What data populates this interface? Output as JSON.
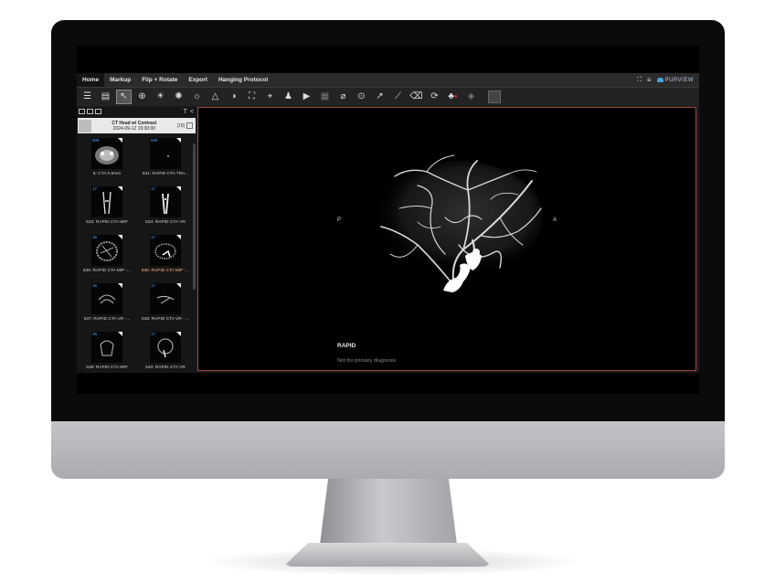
{
  "menu": {
    "items": [
      "Home",
      "Markup",
      "Flip + Rotate",
      "Export",
      "Hanging Protocol"
    ],
    "active": "Home"
  },
  "brand": {
    "name": "PURVIEW",
    "color": "#4aa3df"
  },
  "toolbar": {
    "tools": [
      "list-icon",
      "document-icon",
      "pointer-icon",
      "zoom-icon",
      "brightness-icon",
      "contrast-sun-icon",
      "window-level-icon",
      "triangle-dropdown-icon",
      "invert-icon",
      "fit-icon",
      "crosshair-icon",
      "person-icon",
      "play-icon",
      "layout-icon",
      "link-icon",
      "magnify-icon",
      "arrow-icon",
      "ruler-icon",
      "eraser-icon",
      "rotate-icon",
      "user-record-icon",
      "cube-icon",
      "box-icon"
    ]
  },
  "study": {
    "name": "CT Head w/ Contrast",
    "date": "2024-09-12 19:30:00",
    "badge": "[18]"
  },
  "series": [
    {
      "number": "609",
      "label": "5: CTA 0.5mm",
      "selected": false
    },
    {
      "number": "609",
      "label": "531: RAPID CTA Thin...",
      "selected": false
    },
    {
      "number": "17",
      "label": "533: RAPID CTA MIP",
      "selected": false
    },
    {
      "number": "17",
      "label": "534: RAPID CTA VR",
      "selected": false
    },
    {
      "number": "36",
      "label": "535: RAPID CTA MIP -...",
      "selected": false
    },
    {
      "number": "17",
      "label": "536: RAPID CTA MIP -...",
      "selected": true
    },
    {
      "number": "36",
      "label": "537: RAPID CTA VR -...",
      "selected": false
    },
    {
      "number": "17",
      "label": "538: RAPID CTA VR - ...",
      "selected": false
    },
    {
      "number": "36",
      "label": "539: RAPID CTA MIP",
      "selected": false
    },
    {
      "number": "17",
      "label": "540: RAPID CTA VR",
      "selected": false
    }
  ],
  "viewport": {
    "orientation_left": "P",
    "orientation_right": "A",
    "title": "RAPID",
    "disclaimer": "Not for primary diagnosis",
    "border_color": "#9a4a3c"
  }
}
